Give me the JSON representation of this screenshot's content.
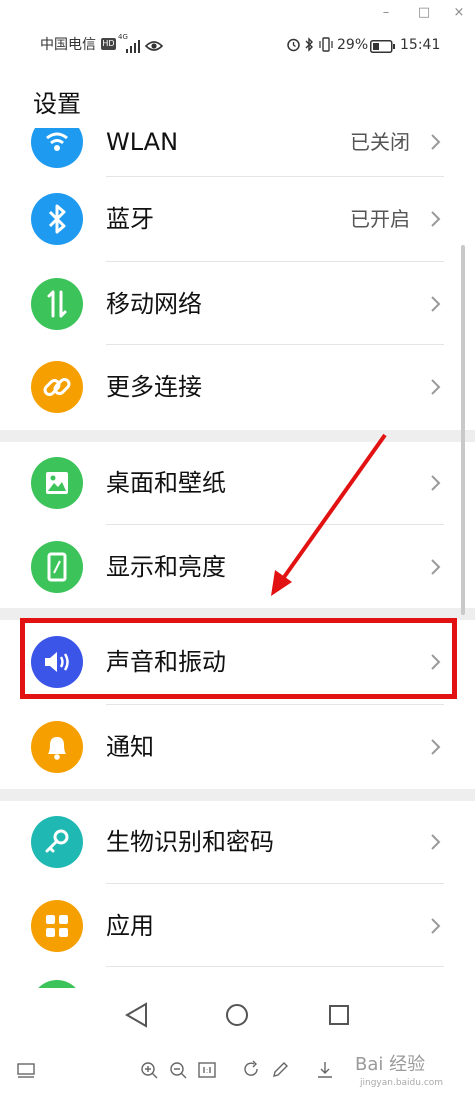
{
  "window": {
    "minimize_glyph": "–",
    "maximize_glyph": "□",
    "close_glyph": "×"
  },
  "status_bar": {
    "carrier": "中国电信",
    "hd_badge": "HD",
    "network": "4G",
    "battery_percent": "29%",
    "time": "15:41"
  },
  "page": {
    "title": "设置"
  },
  "rows": [
    {
      "label": "WLAN",
      "value": "已关闭",
      "icon": "wifi-icon",
      "color": "#1e9bf0"
    },
    {
      "label": "蓝牙",
      "value": "已开启",
      "icon": "bluetooth-icon",
      "color": "#1e9bf0"
    },
    {
      "label": "移动网络",
      "value": "",
      "icon": "mobile-data-icon",
      "color": "#3cc35a"
    },
    {
      "label": "更多连接",
      "value": "",
      "icon": "link-icon",
      "color": "#f5a000"
    },
    {
      "label": "桌面和壁纸",
      "value": "",
      "icon": "image-icon",
      "color": "#3cc35a"
    },
    {
      "label": "显示和亮度",
      "value": "",
      "icon": "phone-brightness-icon",
      "color": "#3cc35a"
    },
    {
      "label": "声音和振动",
      "value": "",
      "icon": "speaker-icon",
      "color": "#3b55e8"
    },
    {
      "label": "通知",
      "value": "",
      "icon": "bell-icon",
      "color": "#f5a000"
    },
    {
      "label": "生物识别和密码",
      "value": "",
      "icon": "key-icon",
      "color": "#1fb8b3"
    },
    {
      "label": "应用",
      "value": "",
      "icon": "apps-grid-icon",
      "color": "#f5a000"
    }
  ],
  "colors": {
    "highlight": "#e21212",
    "arrow": "#e21212"
  },
  "watermark": {
    "text": "Bai 经验",
    "sub": "jingyan.baidu.com"
  }
}
